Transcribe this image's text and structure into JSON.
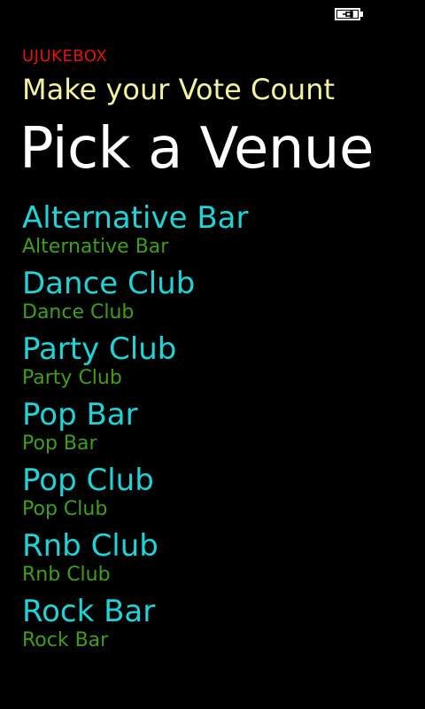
{
  "status_bar": {
    "battery_icon": "battery-charging-icon"
  },
  "header": {
    "app_title": "UJUKEBOX",
    "subtitle": "Make your Vote Count",
    "page_title": "Pick a Venue"
  },
  "venues": [
    {
      "name": "Alternative Bar",
      "detail": "Alternative Bar"
    },
    {
      "name": "Dance Club",
      "detail": "Dance Club"
    },
    {
      "name": "Party Club",
      "detail": "Party Club"
    },
    {
      "name": "Pop Bar",
      "detail": "Pop Bar"
    },
    {
      "name": "Pop Club",
      "detail": "Pop Club"
    },
    {
      "name": "Rnb Club",
      "detail": "Rnb Club"
    },
    {
      "name": "Rock Bar",
      "detail": "Rock Bar"
    }
  ],
  "colors": {
    "app_title": "#e51400",
    "subtitle": "#f2f2a0",
    "venue_name": "#1ed4d6",
    "venue_detail": "#3f9f1a",
    "background": "#000000"
  }
}
